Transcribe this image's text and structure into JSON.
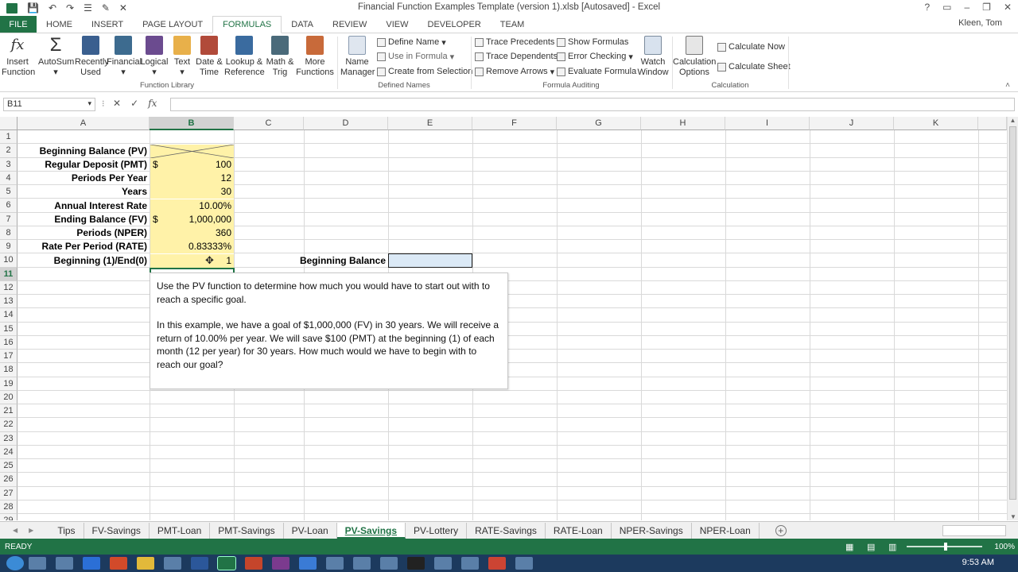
{
  "window": {
    "title": "Financial Function Examples Template (version 1).xlsb [Autosaved] - Excel"
  },
  "tabs": [
    "FILE",
    "HOME",
    "INSERT",
    "PAGE LAYOUT",
    "FORMULAS",
    "DATA",
    "REVIEW",
    "VIEW",
    "DEVELOPER",
    "TEAM"
  ],
  "user": "Kleen, Tom",
  "ribbon": {
    "function_library": {
      "buttons": [
        "Insert\nFunction",
        "AutoSum",
        "Recently\nUsed",
        "Financial",
        "Logical",
        "Text",
        "Date &\nTime",
        "Lookup &\nReference",
        "Math &\nTrig",
        "More\nFunctions"
      ],
      "label": "Function Library"
    },
    "defined_names": {
      "name_manager": "Name\nManager",
      "define_name": "Define Name",
      "use_in_formula": "Use in Formula",
      "create_from_selection": "Create from Selection",
      "label": "Defined Names"
    },
    "formula_auditing": {
      "trace_precedents": "Trace Precedents",
      "trace_dependents": "Trace Dependents",
      "remove_arrows": "Remove Arrows",
      "show_formulas": "Show Formulas",
      "error_checking": "Error Checking",
      "evaluate_formula": "Evaluate Formula",
      "watch_window": "Watch\nWindow",
      "label": "Formula Auditing"
    },
    "calculation": {
      "options": "Calculation\nOptions",
      "calc_now": "Calculate Now",
      "calc_sheet": "Calculate Sheet",
      "label": "Calculation"
    }
  },
  "formula_bar": {
    "name_box": "B11",
    "formula": ""
  },
  "columns": [
    "A",
    "B",
    "C",
    "D",
    "E",
    "F",
    "G",
    "H",
    "I",
    "J",
    "K"
  ],
  "rows": [
    "1",
    "2",
    "3",
    "4",
    "5",
    "6",
    "7",
    "8",
    "9",
    "10",
    "11",
    "12",
    "13",
    "14",
    "15",
    "16",
    "17",
    "18",
    "19",
    "20",
    "21",
    "22",
    "23",
    "24",
    "25",
    "26",
    "27",
    "28",
    "29"
  ],
  "cells": {
    "a2": "Beginning Balance (PV)",
    "a3": "Regular Deposit (PMT)",
    "a4": "Periods Per Year",
    "a5": "Years",
    "a6": "Annual Interest Rate",
    "a7": "Ending Balance (FV)",
    "a8": "Periods (NPER)",
    "a9": "Rate Per Period (RATE)",
    "a10": "Beginning (1)/End(0)",
    "b3_sym": "$",
    "b3": "100",
    "b4": "12",
    "b5": "30",
    "b6": "10.00%",
    "b7_sym": "$",
    "b7": "1,000,000",
    "b8": "360",
    "b9": "0.83333%",
    "b10": "1",
    "d10": "Beginning Balance"
  },
  "textbox": {
    "p1": "Use the PV function to determine how much you would have to start out with to reach a specific goal.",
    "p2": "In this example, we  have a goal of $1,000,000 (FV) in 30 years. We will receive a return of 10.00% per year. We will save $100 (PMT) at the beginning (1) of each month (12 per year) for 30 years. How much would we have to begin with to reach our goal?"
  },
  "sheets": [
    "Tips",
    "FV-Savings",
    "PMT-Loan",
    "PMT-Savings",
    "PV-Loan",
    "PV-Savings",
    "PV-Lottery",
    "RATE-Savings",
    "RATE-Loan",
    "NPER-Savings",
    "NPER-Loan"
  ],
  "active_sheet": "PV-Savings",
  "status": {
    "mode": "READY",
    "zoom": "100%"
  },
  "clock": "9:53 AM",
  "colors": {
    "accent": "#217346",
    "input_fill": "#fff2a8",
    "selected_cell": "#dbe9f6"
  }
}
